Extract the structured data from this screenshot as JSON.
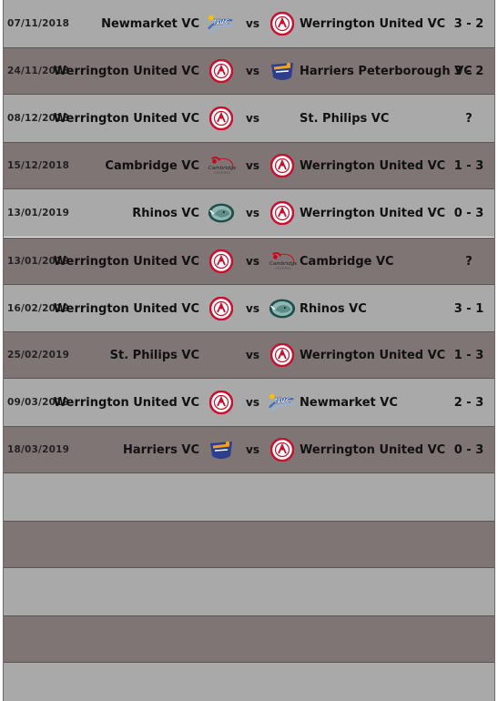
{
  "fixtures": [
    {
      "date": "07/11/2018",
      "home": "Newmarket VC",
      "home_logo": "newmarket-logo",
      "vs": "vs",
      "away": "Werrington United VC",
      "away_logo": "werrington-logo",
      "score": "3 - 2"
    },
    {
      "date": "24/11/2018",
      "home": "Werrington United VC",
      "home_logo": "werrington-logo",
      "vs": "vs",
      "away": "Harriers Peterborough VC",
      "away_logo": "harriers-logo",
      "score": "3 - 2"
    },
    {
      "date": "08/12/2018",
      "home": "Werrington United VC",
      "home_logo": "werrington-logo",
      "vs": "vs",
      "away": "St. Philips VC",
      "away_logo": "",
      "score": "?"
    },
    {
      "date": "15/12/2018",
      "home": "Cambridge VC",
      "home_logo": "cambridge-logo",
      "vs": "vs",
      "away": "Werrington United VC",
      "away_logo": "werrington-logo",
      "score": "1 - 3"
    },
    {
      "date": "13/01/2019",
      "home": "Rhinos VC",
      "home_logo": "rhinos-logo",
      "vs": "vs",
      "away": "Werrington United VC",
      "away_logo": "werrington-logo",
      "score": "0 - 3"
    },
    {
      "date": "13/01/2019",
      "home": "Werrington United VC",
      "home_logo": "werrington-logo",
      "vs": "vs",
      "away": "Cambridge VC",
      "away_logo": "cambridge-logo",
      "score": "?"
    },
    {
      "date": "16/02/2019",
      "home": "Werrington United VC",
      "home_logo": "werrington-logo",
      "vs": "vs",
      "away": "Rhinos VC",
      "away_logo": "rhinos-logo",
      "score": "3 - 1"
    },
    {
      "date": "25/02/2019",
      "home": "St. Philips VC",
      "home_logo": "",
      "vs": "vs",
      "away": "Werrington United VC",
      "away_logo": "werrington-logo",
      "score": "1 - 3"
    },
    {
      "date": "09/03/2019",
      "home": "Werrington United VC",
      "home_logo": "werrington-logo",
      "vs": "vs",
      "away": "Newmarket VC",
      "away_logo": "newmarket-logo",
      "score": "2 - 3"
    },
    {
      "date": "18/03/2019",
      "home": "Harriers VC",
      "home_logo": "harriers-logo",
      "vs": "vs",
      "away": "Werrington United VC",
      "away_logo": "werrington-logo",
      "score": "0 - 3"
    }
  ],
  "empty_rows": 5,
  "colors": {
    "row_light": "#a9a9a9",
    "row_dark": "#7f7575",
    "text": "#111111"
  }
}
